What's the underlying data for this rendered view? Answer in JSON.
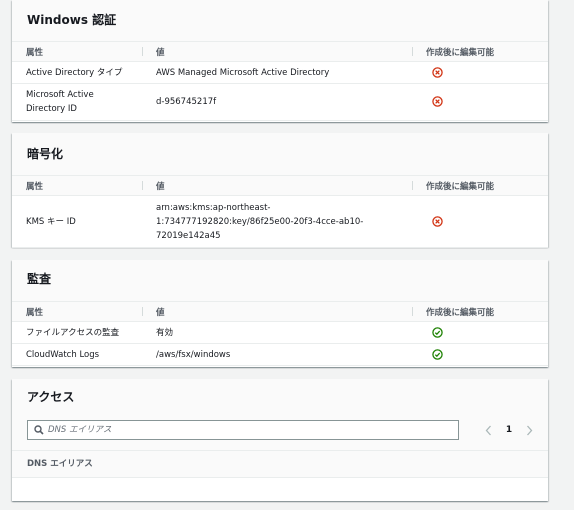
{
  "windows_auth": {
    "title": "Windows 認証",
    "headers": [
      "属性",
      "値",
      "作成後に編集可能"
    ],
    "rows": [
      {
        "attr": "Active Directory タイプ",
        "value": "AWS Managed Microsoft Active Directory",
        "editable": "no"
      },
      {
        "attr_lines": [
          "Microsoft Active",
          "Directory ID"
        ],
        "value": "d-956745217f",
        "editable": "no"
      }
    ]
  },
  "encryption": {
    "title": "暗号化",
    "headers": [
      "属性",
      "値",
      "作成後に編集可能"
    ],
    "rows": [
      {
        "attr": "KMS キー ID",
        "value_lines": [
          "arn:aws:kms:ap-northeast-",
          "1:734777192820:key/86f25e00-20f3-4cce-ab10-",
          "72019e142a45"
        ],
        "editable": "no"
      }
    ]
  },
  "audit": {
    "title": "監査",
    "headers": [
      "属性",
      "値",
      "作成後に編集可能"
    ],
    "rows": [
      {
        "attr": "ファイルアクセスの監査",
        "value": "有効",
        "editable": "yes"
      },
      {
        "attr": "CloudWatch Logs",
        "value": "/aws/fsx/windows",
        "editable": "yes"
      }
    ]
  },
  "access": {
    "title": "アクセス",
    "search_placeholder": "DNS エイリアス",
    "page": "1",
    "column_header": "DNS エイリアス"
  },
  "icons": {
    "not_editable": "x-circle-icon",
    "editable": "check-circle-icon"
  },
  "colors": {
    "not_editable": "#d13212",
    "editable": "#1d8102",
    "border": "#eaeded",
    "header_text": "#545b64"
  }
}
